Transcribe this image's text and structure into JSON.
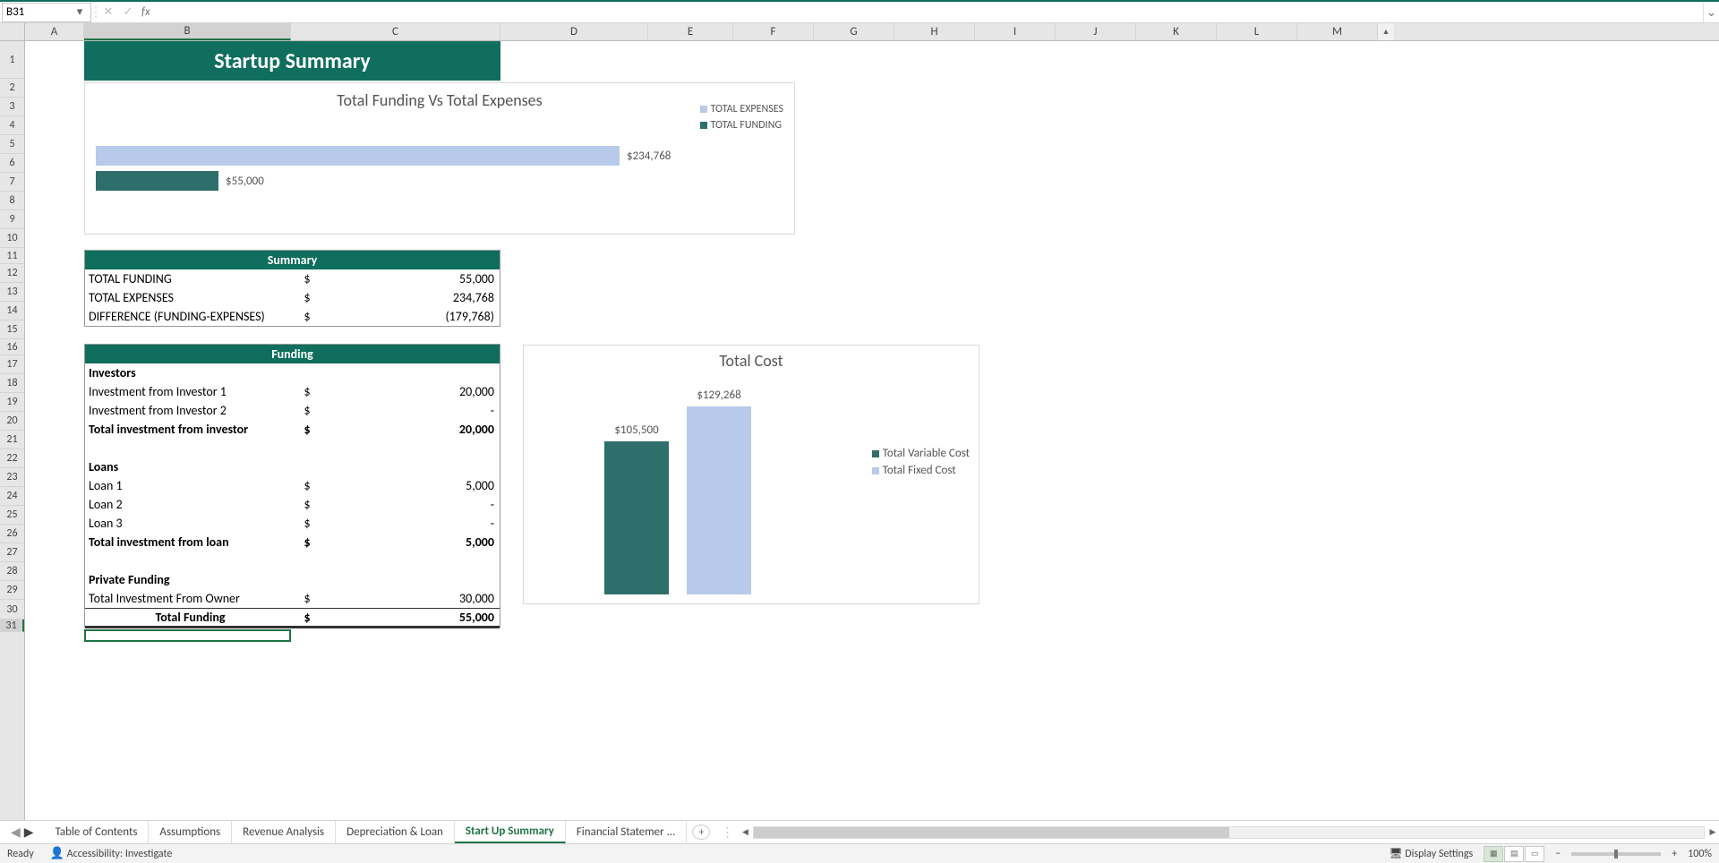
{
  "name_box": "B31",
  "formula": "",
  "columns": [
    "A",
    "B",
    "C",
    "D",
    "E",
    "F",
    "G",
    "H",
    "I",
    "J",
    "K",
    "L",
    "M"
  ],
  "rows": [
    1,
    2,
    3,
    4,
    5,
    6,
    7,
    8,
    9,
    10,
    11,
    12,
    13,
    14,
    15,
    16,
    17,
    18,
    19,
    20,
    21,
    22,
    23,
    24,
    25,
    26,
    27,
    28,
    29,
    30,
    31
  ],
  "title_banner": "Startup Summary",
  "chart1": {
    "title": "Total Funding Vs Total Expenses",
    "legend": [
      "TOTAL EXPENSES",
      "TOTAL FUNDING"
    ],
    "bars": [
      {
        "label": "$234,768",
        "value": 234768,
        "color": "#b7cae9"
      },
      {
        "label": "$55,000",
        "value": 55000,
        "color": "#2f6f6b"
      }
    ]
  },
  "summary_table_head": "Summary",
  "summary_table": [
    {
      "label": "TOTAL FUNDING",
      "cur": "$",
      "val": "55,000"
    },
    {
      "label": "TOTAL EXPENSES",
      "cur": "$",
      "val": "234,768"
    },
    {
      "label": "DIFFERENCE (FUNDING-EXPENSES)",
      "cur": "$",
      "val": "(179,768)"
    }
  ],
  "funding_table_head": "Funding",
  "funding_rows": [
    {
      "label": "Investors",
      "cur": "",
      "val": "",
      "bold": true
    },
    {
      "label": "Investment from Investor 1",
      "cur": "$",
      "val": "20,000"
    },
    {
      "label": "Investment from Investor 2",
      "cur": "$",
      "val": "-"
    },
    {
      "label": "Total investment from investor",
      "cur": "$",
      "val": "20,000",
      "bold": true
    },
    {
      "label": "",
      "cur": "",
      "val": ""
    },
    {
      "label": "Loans",
      "cur": "",
      "val": "",
      "bold": true
    },
    {
      "label": "Loan 1",
      "cur": "$",
      "val": "5,000"
    },
    {
      "label": "Loan 2",
      "cur": "$",
      "val": "-"
    },
    {
      "label": "Loan 3",
      "cur": "$",
      "val": "-"
    },
    {
      "label": "Total investment from loan",
      "cur": "$",
      "val": "5,000",
      "bold": true
    },
    {
      "label": "",
      "cur": "",
      "val": ""
    },
    {
      "label": "Private Funding",
      "cur": "",
      "val": "",
      "bold": true
    },
    {
      "label": "Total Investment From Owner",
      "cur": "$",
      "val": "30,000"
    },
    {
      "label": "Total Funding",
      "cur": "$",
      "val": "55,000",
      "bold": true,
      "center": true,
      "total": true
    }
  ],
  "chart2": {
    "title": "Total Cost",
    "bars": [
      {
        "label": "$105,500",
        "value": 105500,
        "color": "#2f6f6b",
        "name": "Total Variable Cost"
      },
      {
        "label": "$129,268",
        "value": 129268,
        "color": "#b7cae9",
        "name": "Total Fixed Cost"
      }
    ]
  },
  "chart_data": [
    {
      "type": "bar",
      "orientation": "horizontal",
      "title": "Total Funding Vs Total Expenses",
      "series": [
        {
          "name": "TOTAL EXPENSES",
          "values": [
            234768
          ],
          "color": "#b7cae9"
        },
        {
          "name": "TOTAL FUNDING",
          "values": [
            55000
          ],
          "color": "#2f6f6b"
        }
      ],
      "xlabel": "",
      "ylabel": "",
      "xlim": [
        0,
        250000
      ],
      "legend_position": "right",
      "data_labels": true
    },
    {
      "type": "bar",
      "orientation": "vertical",
      "title": "Total Cost",
      "categories": [
        "Total Variable Cost",
        "Total Fixed Cost"
      ],
      "values": [
        105500,
        129268
      ],
      "colors": [
        "#2f6f6b",
        "#b7cae9"
      ],
      "ylim": [
        0,
        140000
      ],
      "legend_position": "right",
      "data_labels": true
    }
  ],
  "sheet_tabs": [
    {
      "label": "Table of Contents"
    },
    {
      "label": "Assumptions"
    },
    {
      "label": "Revenue Analysis"
    },
    {
      "label": "Depreciation & Loan"
    },
    {
      "label": "Start Up Summary",
      "active": true
    },
    {
      "label": "Financial Statemer ..."
    }
  ],
  "status": {
    "ready": "Ready",
    "accessibility": "Accessibility: Investigate",
    "display": "Display Settings",
    "zoom": "100%"
  },
  "row_heights": {
    "1": 42,
    "12": 21,
    "13": 21,
    "14": 21,
    "default": 21
  }
}
